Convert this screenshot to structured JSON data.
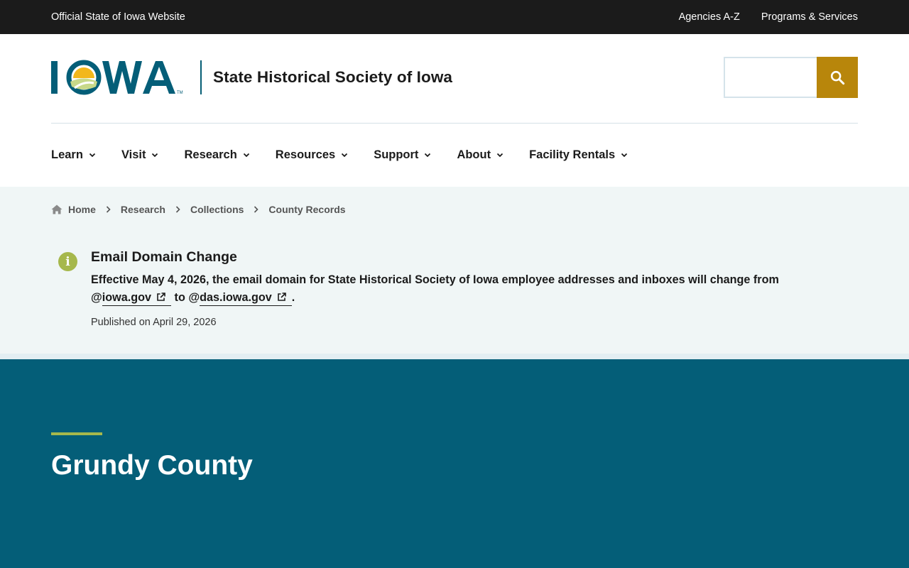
{
  "topbar": {
    "official_text": "Official State of Iowa Website",
    "links": [
      "Agencies A-Z",
      "Programs & Services"
    ]
  },
  "header": {
    "logo_text": "IOWA",
    "logo_trademark": "TM",
    "site_title": "State Historical Society of Iowa",
    "search_placeholder": "",
    "search_button_icon": "search-icon"
  },
  "nav": {
    "items": [
      {
        "label": "Learn"
      },
      {
        "label": "Visit"
      },
      {
        "label": "Research"
      },
      {
        "label": "Resources"
      },
      {
        "label": "Support"
      },
      {
        "label": "About"
      },
      {
        "label": "Facility Rentals"
      }
    ]
  },
  "breadcrumb": {
    "items": [
      "Home",
      "Research",
      "Collections",
      "County Records"
    ]
  },
  "alert": {
    "icon_letter": "i",
    "title": "Email Domain Change",
    "text_before": "Effective May 4, 2026, the email domain for State Historical Society of Iowa employee addresses and inboxes will change from @",
    "link1": "iowa.gov",
    "text_middle": " to @",
    "link2": "das.iowa.gov",
    "text_after": ".",
    "published": "Published on April 29, 2026"
  },
  "hero": {
    "title": "Grundy County"
  },
  "colors": {
    "topbar_bg": "#1b1b1b",
    "brand_teal": "#045e78",
    "search_button": "#b8860b",
    "accent_green": "#a6b84c",
    "light_band": "#f0f6f6"
  }
}
